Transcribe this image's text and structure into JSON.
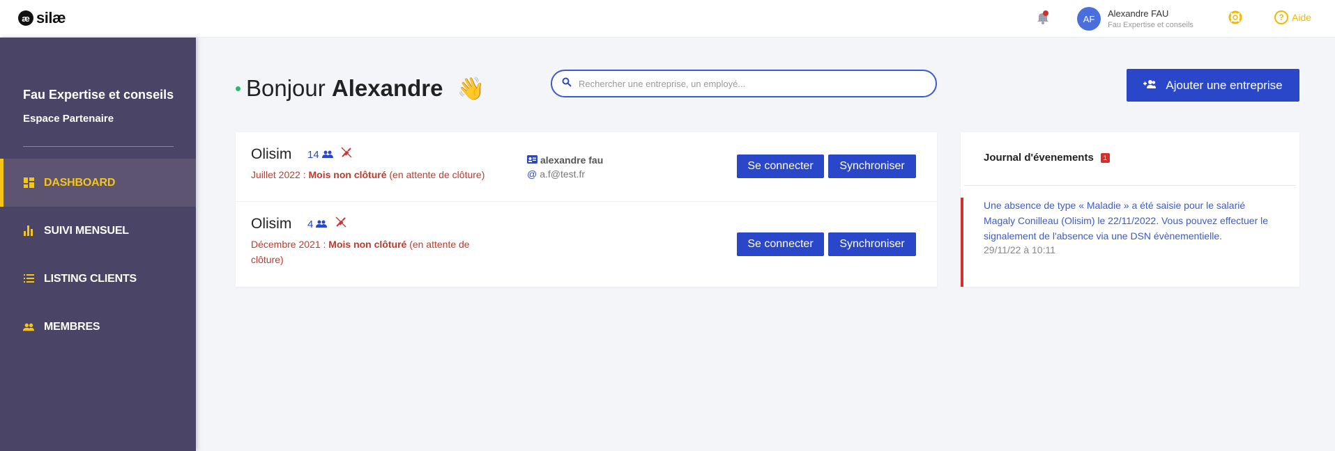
{
  "header": {
    "logo_mark": "æ",
    "logo_text": "silæ",
    "user_initials": "AF",
    "user_name": "Alexandre FAU",
    "user_org": "Fau Expertise et conseils",
    "help_label": "Aide"
  },
  "sidebar": {
    "org_title": "Fau Expertise et conseils",
    "org_subtitle": "Espace Partenaire",
    "items": [
      {
        "label": "DASHBOARD",
        "icon": "dashboard-icon",
        "active": true
      },
      {
        "label": "SUIVI MENSUEL",
        "icon": "bar-chart-icon",
        "active": false
      },
      {
        "label": "LISTING CLIENTS",
        "icon": "list-icon",
        "active": false
      },
      {
        "label": "MEMBRES",
        "icon": "people-icon",
        "active": false
      }
    ]
  },
  "main": {
    "greeting_prefix": "Bonjour",
    "greeting_name": "Alexandre",
    "wave": "👋",
    "search_placeholder": "Rechercher une entreprise, un employé...",
    "add_button": "Ajouter une entreprise"
  },
  "companies": [
    {
      "name": "Olisim",
      "count": "14",
      "period": "Juillet 2022 :",
      "status_bold": "Mois non clôturé",
      "status_note": "(en attente de clôture)",
      "contact_name": "alexandre fau",
      "contact_email": "a.f@test.fr",
      "connect_label": "Se connecter",
      "sync_label": "Synchroniser"
    },
    {
      "name": "Olisim",
      "count": "4",
      "period": "Décembre 2021 :",
      "status_bold": "Mois non clôturé",
      "status_note": "(en attente de clôture)",
      "connect_label": "Se connecter",
      "sync_label": "Synchroniser"
    }
  ],
  "journal": {
    "title": "Journal d'évenements",
    "badge": "1",
    "entry_text": "Une absence de type « Maladie » a été saisie pour le salarié Magaly Conilleau (Olisim) le 22/11/2022. Vous pouvez effectuer le signalement de l'absence via une DSN évènementielle.",
    "entry_time": "29/11/22 à 10:11"
  },
  "colors": {
    "primary": "#2a47c9",
    "sidebar": "#4a4466",
    "accent": "#f5c518",
    "alert": "#d32f2f"
  }
}
